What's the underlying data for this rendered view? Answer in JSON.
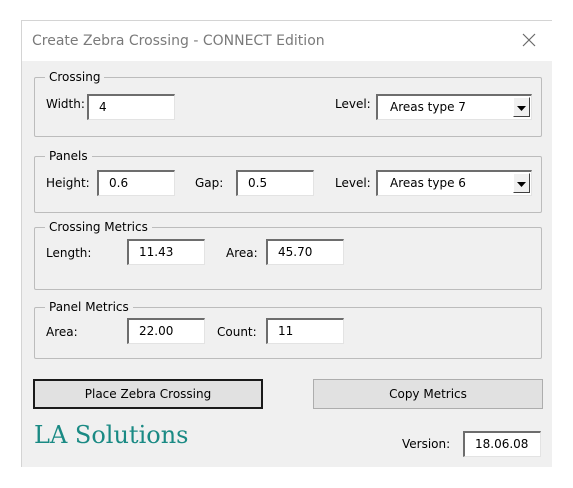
{
  "window": {
    "title": "Create Zebra Crossing - CONNECT Edition",
    "close_icon": "close-icon"
  },
  "crossing": {
    "legend": "Crossing",
    "width_label": "Width:",
    "width_value": "4",
    "level_label": "Level:",
    "level_value": "Areas type 7"
  },
  "panels": {
    "legend": "Panels",
    "height_label": "Height:",
    "height_value": "0.6",
    "gap_label": "Gap:",
    "gap_value": "0.5",
    "level_label": "Level:",
    "level_value": "Areas type 6"
  },
  "crossing_metrics": {
    "legend": "Crossing Metrics",
    "length_label": "Length:",
    "length_value": "11.43",
    "area_label": "Area:",
    "area_value": "45.70"
  },
  "panel_metrics": {
    "legend": "Panel Metrics",
    "area_label": "Area:",
    "area_value": "22.00",
    "count_label": "Count:",
    "count_value": "11"
  },
  "buttons": {
    "place": "Place Zebra Crossing",
    "copy": "Copy Metrics"
  },
  "footer": {
    "brand": "LA Solutions",
    "version_label": "Version:",
    "version_value": "18.06.08"
  },
  "colors": {
    "brand": "#1a8a84",
    "dialog_bg": "#f0f0f0",
    "title_text": "#7a7a7a"
  }
}
